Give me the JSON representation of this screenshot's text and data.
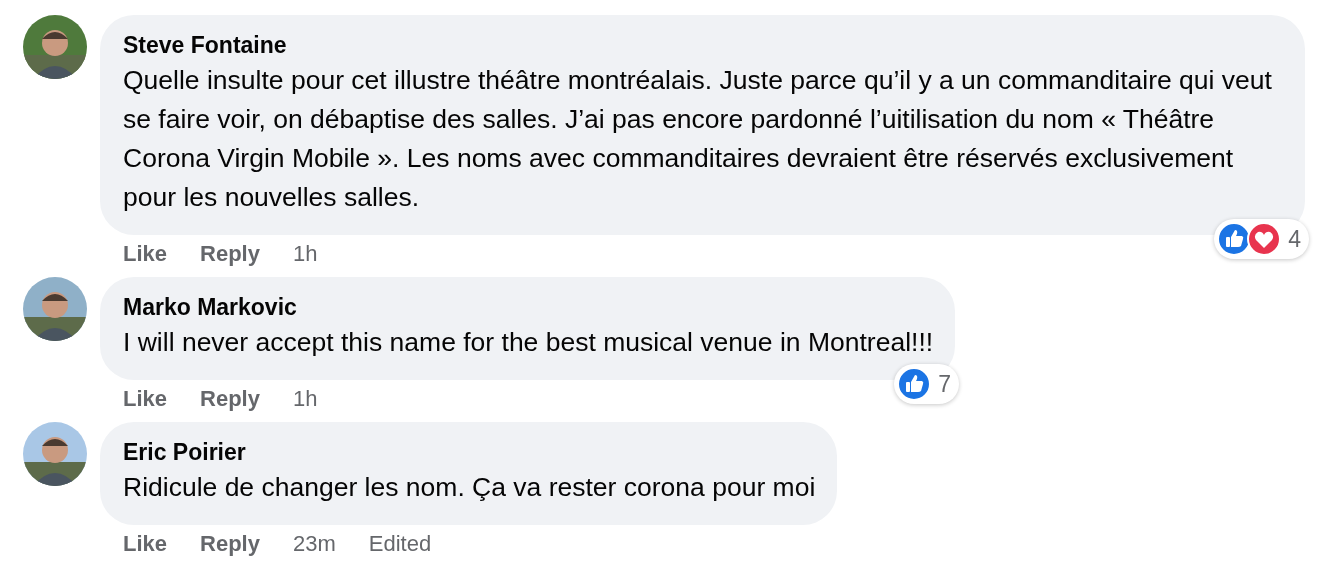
{
  "comments": [
    {
      "author": "Steve Fontaine",
      "text": "Quelle insulte pour cet illustre théâtre montréalais. Juste parce qu’il y a un commanditaire qui veut se faire voir, on débaptise des salles. J’ai pas encore pardonné l’uitilisation du nom « Théâtre Corona Virgin Mobile ». Les noms avec commanditaires devraient être réservés exclusivement pour les nouvelles salles.",
      "reactions": {
        "kinds": [
          {
            "kind": "like"
          },
          {
            "kind": "love"
          }
        ],
        "count": "4"
      },
      "actions": [
        {
          "kind": "link",
          "label": "Like"
        },
        {
          "kind": "link",
          "label": "Reply"
        },
        {
          "kind": "time",
          "label": "1h"
        }
      ]
    },
    {
      "author": "Marko Markovic",
      "text": "I will never accept this name for the best musical venue in Montreal!!!",
      "reactions": {
        "kinds": [
          {
            "kind": "like"
          }
        ],
        "count": "7"
      },
      "actions": [
        {
          "kind": "link",
          "label": "Like"
        },
        {
          "kind": "link",
          "label": "Reply"
        },
        {
          "kind": "time",
          "label": "1h"
        }
      ]
    },
    {
      "author": "Eric Poirier",
      "text": "Ridicule de changer les nom. Ça va rester corona pour moi",
      "actions": [
        {
          "kind": "link",
          "label": "Like"
        },
        {
          "kind": "link",
          "label": "Reply"
        },
        {
          "kind": "time",
          "label": "23m"
        },
        {
          "kind": "note",
          "label": "Edited"
        }
      ]
    }
  ]
}
